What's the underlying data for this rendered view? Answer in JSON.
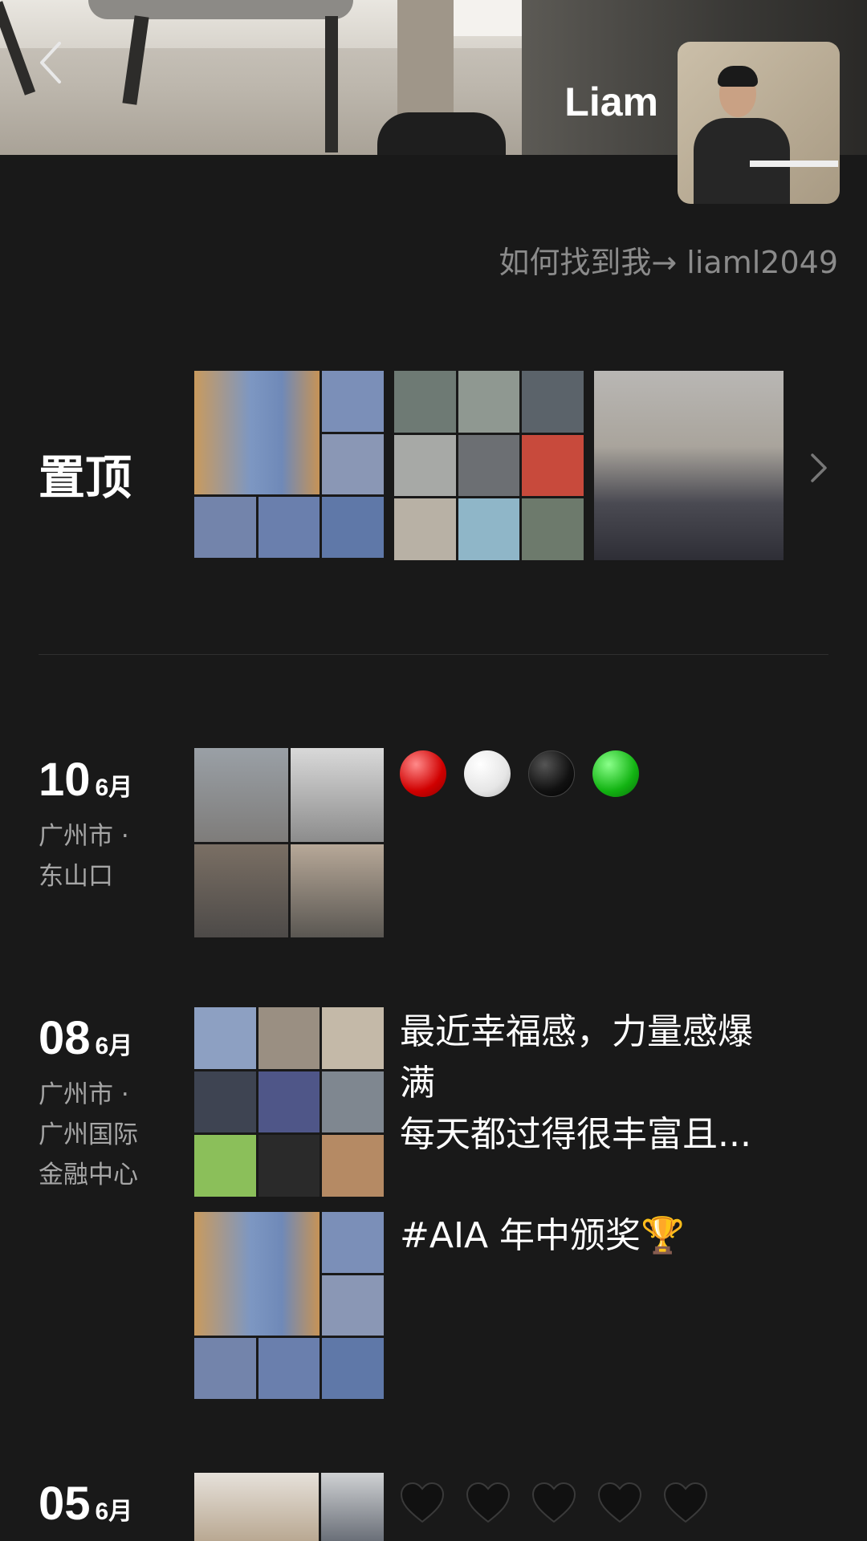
{
  "profile": {
    "name": "Liam",
    "link_text": "如何找到我→ liaml2049"
  },
  "pinned": {
    "label": "置顶",
    "thumbnails": [
      "photo-grid-team-event",
      "photo-grid-office",
      "photo-group-seated"
    ]
  },
  "posts": [
    {
      "day": "10",
      "month": "6月",
      "location_line1": "广州市 ·",
      "location_line2": "东山口",
      "location_line3": "",
      "text": "",
      "emoji": [
        "red-circle",
        "white-circle",
        "black-circle",
        "green-circle"
      ]
    },
    {
      "day": "08",
      "month": "6月",
      "location_line1": "广州市 ·",
      "location_line2": "广州国际",
      "location_line3": "金融中心",
      "text_line1": "最近幸福感，力量感爆",
      "text_line2": "满",
      "text_line3": "每天都过得很丰富且...",
      "second_text": "#AIA 年中颁奖🏆"
    },
    {
      "day": "05",
      "month": "6月",
      "text": "",
      "emoji": [
        "black-heart",
        "black-heart",
        "black-heart",
        "black-heart",
        "black-heart"
      ]
    }
  ],
  "colors": {
    "background": "#191919",
    "secondary_text": "#8b8b8b",
    "location_text": "#a6a6a6"
  }
}
